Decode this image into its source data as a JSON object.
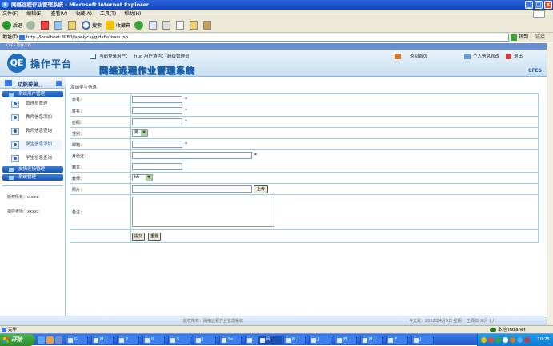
{
  "window": {
    "title": "网络远程作业管理系统 - Microsoft Internet Explorer"
  },
  "menu": [
    "文件(F)",
    "编辑(E)",
    "查看(V)",
    "收藏(A)",
    "工具(T)",
    "帮助(H)"
  ],
  "toolbar": {
    "back": "后退",
    "search": "搜索",
    "favorites": "收藏夹"
  },
  "address": {
    "label": "地址(D)",
    "url": "http://localhost:8080/jspelycxygldxfv/main.jsp",
    "go": "转到",
    "links": "链接"
  },
  "app": {
    "strip": "CFES 软件工作",
    "logo_text": "操作平台",
    "logo_mark": "QE",
    "current_user_label": "当前登录用户：",
    "current_user": "hug",
    "role_label": "用户角色：",
    "role": "超级管理员",
    "home_link": "返回首页",
    "profile_link": "个人信息修改",
    "logout_link": "退出",
    "system_name": "网络远程作业管理系统",
    "brand": "CFES"
  },
  "sidebar": {
    "title": "功能菜单",
    "subtitle": "FUNCTION MENU",
    "group1": "系统用户管理",
    "items": [
      "管理员管理",
      "教师信息添加",
      "教师信息查询",
      "学生信息添加",
      "学生信息查询"
    ],
    "group2": "友情连接管理",
    "group3": "系统管理",
    "copyright": "版权所有：xxxxx",
    "advisor": "指导老师：xxxxx"
  },
  "form": {
    "page_title": "添加学生信息",
    "labels": {
      "student_id": "学号：",
      "name": "姓名：",
      "password": "密码：",
      "gender": "性别：",
      "email": "邮箱：",
      "id_card": "身份证：",
      "address": "籍贯：",
      "teacher": "教师：",
      "photo": "照片：",
      "remark": "备注："
    },
    "required": "*",
    "gender_value": "男",
    "teacher_value": "hh",
    "upload": "上传",
    "submit": "提交",
    "reset": "重置"
  },
  "footer": {
    "copyright": "版权所有：网络远程作业管理系统",
    "date": "今天是：2012年4月9日 星期一 壬辰年 三月十九"
  },
  "status": {
    "left": "完毕",
    "zone": "本地 Intranet"
  },
  "taskbar": {
    "start": "开始",
    "tasks": [
      "G...",
      "M...",
      "2...",
      "0...",
      "S...",
      "J...",
      "Se...",
      "J...",
      "网...",
      "M...",
      "J...",
      "开...",
      "M...",
      "E...",
      "J..."
    ],
    "clock": "10:25"
  }
}
